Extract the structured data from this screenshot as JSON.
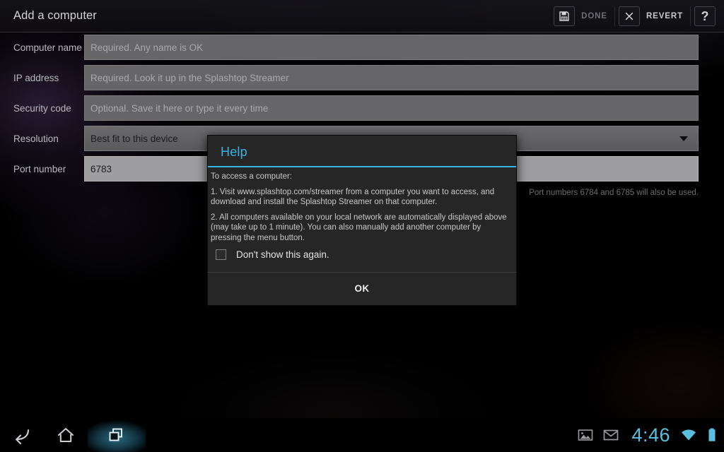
{
  "action_bar": {
    "title": "Add a computer",
    "actions": [
      {
        "icon": "save-floppy-icon",
        "label": "DONE"
      },
      {
        "icon": "close-x-icon",
        "label": "REVERT"
      },
      {
        "icon": "help-question-icon",
        "label": "?"
      }
    ]
  },
  "form": {
    "rows": [
      {
        "label": "Computer name",
        "type": "text",
        "value": "",
        "placeholder": "Required. Any name is OK"
      },
      {
        "label": "IP address",
        "type": "text",
        "value": "",
        "placeholder": "Required. Look it up in the Splashtop Streamer"
      },
      {
        "label": "Security code",
        "type": "text",
        "value": "",
        "placeholder": "Optional. Save it here or type it every time"
      },
      {
        "label": "Resolution",
        "type": "spinner",
        "value": "Best fit to this device",
        "placeholder": ""
      },
      {
        "label": "Port number",
        "type": "text",
        "value": "6783",
        "placeholder": ""
      }
    ],
    "hint": "Port numbers 6784 and 6785 will also be used."
  },
  "dialog": {
    "title": "Help",
    "paragraphs": [
      "To access a computer:",
      "1. Visit www.splashtop.com/streamer from a computer you want to access, and download and install the Splashtop Streamer on that computer.",
      "2. All computers available on your local network are automatically displayed above (may take up to 1 minute). You can also manually add another computer by pressing the menu button."
    ],
    "checkbox_label": "Don't show this again.",
    "checkbox_checked": false,
    "ok_label": "OK",
    "accent_color": "#33b5e5"
  },
  "system_bar": {
    "nav": [
      {
        "icon": "back-icon"
      },
      {
        "icon": "home-icon"
      },
      {
        "icon": "recent-apps-icon"
      }
    ],
    "status": {
      "icons": [
        "screenshot-image-icon",
        "gmail-envelope-icon"
      ],
      "time": "4:46",
      "wifi_icon": "wifi-icon",
      "battery_icon": "battery-icon",
      "accent_color": "#59c0e0"
    }
  }
}
